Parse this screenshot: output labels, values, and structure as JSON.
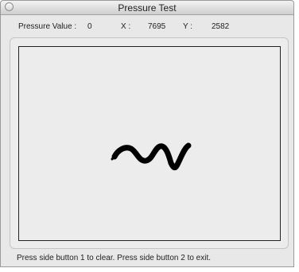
{
  "window": {
    "title": "Pressure Test"
  },
  "readout": {
    "pressure_label": "Pressure Value :",
    "pressure_value": "0",
    "x_label": "X :",
    "x_value": "7695",
    "y_label": "Y :",
    "y_value": "2582"
  },
  "canvas": {
    "stroke_color": "#000000",
    "background_color": "#ececec"
  },
  "footer": {
    "hint": "Press side button 1 to clear. Press side button 2 to exit."
  }
}
